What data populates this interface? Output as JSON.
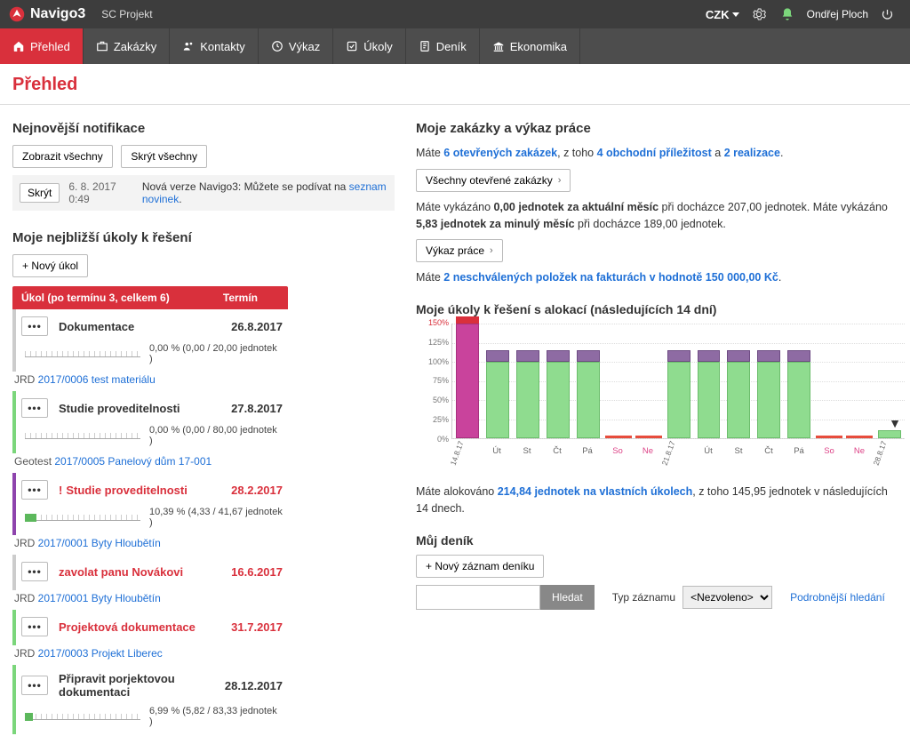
{
  "brand": "Navigo3",
  "workspace": "SC Projekt",
  "currency": "CZK",
  "user_name": "Ondřej Ploch",
  "nav": [
    {
      "label": "Přehled"
    },
    {
      "label": "Zakázky"
    },
    {
      "label": "Kontakty"
    },
    {
      "label": "Výkaz"
    },
    {
      "label": "Úkoly"
    },
    {
      "label": "Deník"
    },
    {
      "label": "Ekonomika"
    }
  ],
  "page_title": "Přehled",
  "notifications": {
    "heading": "Nejnovější notifikace",
    "show_all": "Zobrazit všechny",
    "hide_all": "Skrýt všechny",
    "hide": "Skrýt",
    "item": {
      "date": "6. 8. 2017 0:49",
      "text_before": "Nová verze Navigo3: Můžete se podívat na ",
      "link": "seznam novinek",
      "text_after": "."
    }
  },
  "tasks": {
    "heading": "Moje nejbližší úkoly k řešení",
    "new_task": "+  Nový úkol",
    "header_task": "Úkol (po termínu 3, celkem 6)",
    "header_term": "Termín",
    "rows": [
      {
        "title": "Dokumentace",
        "term": "26.8.2017",
        "progress_text": "0,00 % (0,00 / 20,00 jednotek )",
        "fill_pct": 0,
        "project_pref": "JRD",
        "project": "2017/0006 test materiálu",
        "color": "plain",
        "red": false,
        "bang": false
      },
      {
        "title": "Studie proveditelnosti",
        "term": "27.8.2017",
        "progress_text": "0,00 % (0,00 / 80,00 jednotek )",
        "fill_pct": 0,
        "project_pref": "Geotest",
        "project": "2017/0005 Panelový dům 17-001",
        "color": "green",
        "red": false,
        "bang": false
      },
      {
        "title": "Studie proveditelnosti",
        "term": "28.2.2017",
        "progress_text": "10,39 % (4,33 / 41,67 jednotek )",
        "fill_pct": 10,
        "project_pref": "JRD",
        "project": "2017/0001 Byty Hloubětín",
        "color": "purple",
        "red": true,
        "bang": true
      },
      {
        "title": "zavolat panu Novákovi",
        "term": "16.6.2017",
        "progress_text": "",
        "fill_pct": null,
        "project_pref": "JRD",
        "project": "2017/0001 Byty Hloubětín",
        "color": "plain",
        "red": true,
        "bang": false
      },
      {
        "title": "Projektová dokumentace",
        "term": "31.7.2017",
        "progress_text": "",
        "fill_pct": null,
        "project_pref": "JRD",
        "project": "2017/0003 Projekt Liberec",
        "color": "green",
        "red": true,
        "bang": false
      },
      {
        "title": "Připravit porjektovou dokumentaci",
        "term": "28.12.2017",
        "progress_text": "6,99 % (5,82 / 83,33 jednotek )",
        "fill_pct": 7,
        "project_pref": "",
        "project": "",
        "color": "green",
        "red": false,
        "bang": false
      }
    ]
  },
  "orders": {
    "heading": "Moje zakázky a výkaz práce",
    "line1_a": "Máte ",
    "line1_b": "6 otevřených zakázek",
    "line1_c": ", z toho ",
    "line1_d": "4 obchodní příležitost",
    "line1_e": " a ",
    "line1_f": "2 realizace",
    "line1_g": ".",
    "btn_orders": "Všechny otevřené zakázky",
    "line2_a": "Máte vykázáno ",
    "line2_b": "0,00 jednotek za aktuální měsíc",
    "line2_c": " při docházce 207,00 jednotek. Máte vykázáno ",
    "line2_d": "5,83 jednotek za minulý měsíc",
    "line2_e": " při docházce 189,00 jednotek.",
    "btn_report": "Výkaz práce",
    "line3_a": "Máte ",
    "line3_b": "2 neschválených položek na fakturách v hodnotě 150 000,00 Kč",
    "line3_c": "."
  },
  "alloc": {
    "heading": "Moje úkoly k řešení s alokací (následujících 14 dní)",
    "foot_a": "Máte alokováno ",
    "foot_b": "214,84 jednotek na vlastních úkolech",
    "foot_c": ", z toho 145,95 jednotek v následujících 14 dnech."
  },
  "chart_data": {
    "type": "bar",
    "ylabel_pct": true,
    "ylim": [
      0,
      150
    ],
    "yticks": [
      "150%",
      "125%",
      "100%",
      "75%",
      "50%",
      "25%",
      "0%"
    ],
    "categories": [
      "14.8.17",
      "Út",
      "St",
      "Čt",
      "Pá",
      "So",
      "Ne",
      "21.8.17",
      "Út",
      "St",
      "Čt",
      "Pá",
      "So",
      "Ne",
      "28.8.17"
    ],
    "series": [
      {
        "name": "green",
        "values": [
          150,
          100,
          100,
          100,
          100,
          0,
          0,
          100,
          100,
          100,
          100,
          100,
          0,
          0,
          10
        ]
      },
      {
        "name": "purple_top",
        "values": [
          30,
          15,
          15,
          15,
          15,
          0,
          0,
          15,
          15,
          15,
          15,
          15,
          0,
          0,
          0
        ]
      },
      {
        "name": "red_underline",
        "values": [
          0,
          0,
          0,
          0,
          0,
          1,
          1,
          0,
          0,
          0,
          0,
          0,
          1,
          1,
          0
        ]
      }
    ],
    "over_100_marker_on": [
      0
    ]
  },
  "diary": {
    "heading": "Můj deník",
    "new_entry": "+  Nový záznam deníku",
    "search_btn": "Hledat",
    "type_label": "Typ záznamu",
    "type_value": "<Nezvoleno>",
    "advanced": "Podrobnější hledání",
    "search_placeholder": ""
  }
}
